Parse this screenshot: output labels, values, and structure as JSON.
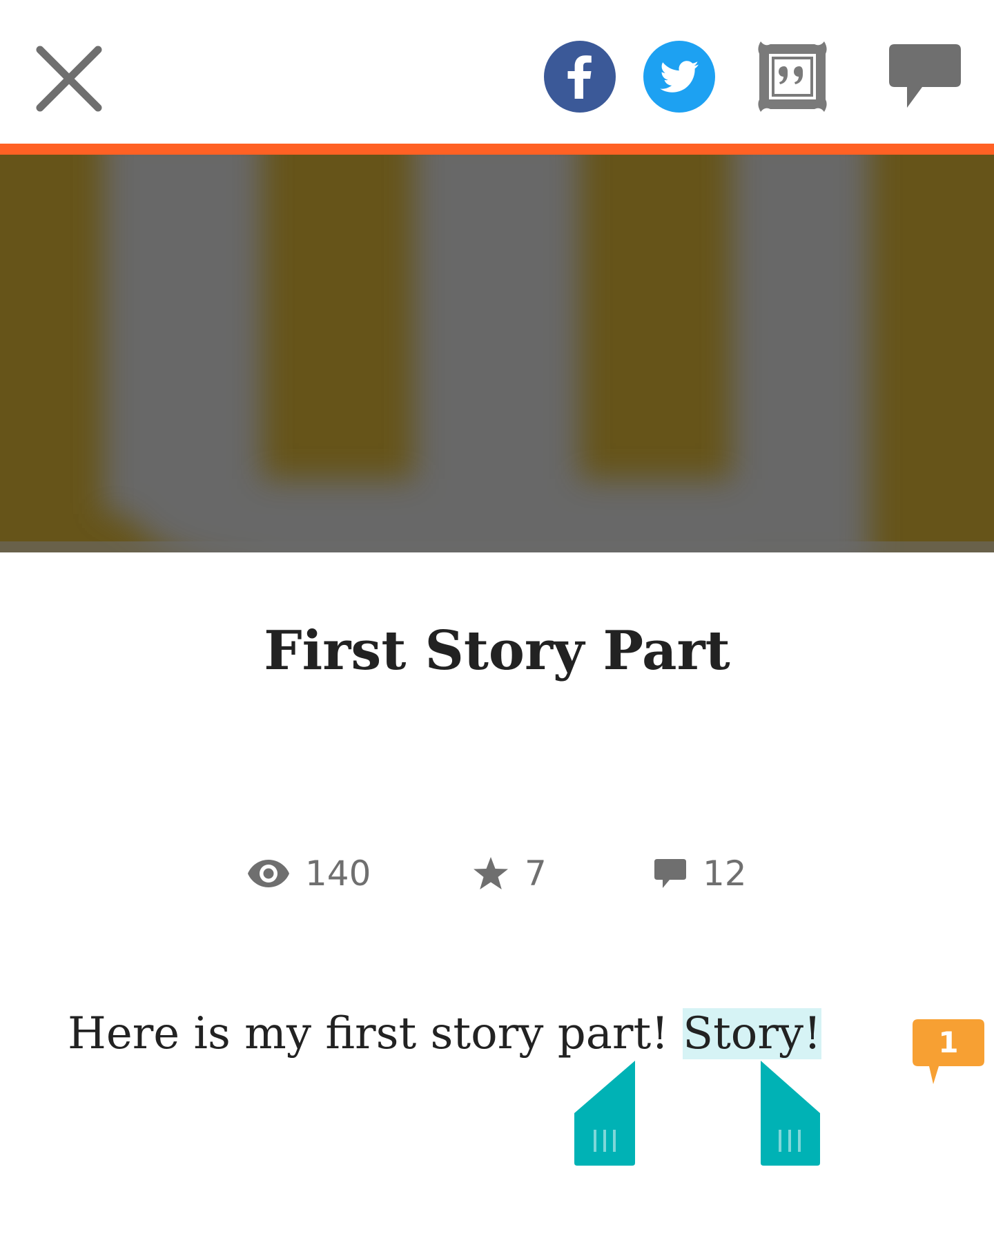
{
  "toolbar": {
    "close_icon": "close-icon",
    "share_facebook_icon": "facebook-icon",
    "share_twitter_icon": "twitter-icon",
    "quote_icon": "quote-frame-icon",
    "comments_icon": "comment-bubble-icon",
    "facebook_color": "#3b5998",
    "twitter_color": "#1da1f2",
    "icon_gray": "#6f6f6f"
  },
  "progress": {
    "fraction": 1.0,
    "color": "#ff6124"
  },
  "story": {
    "title": "First Story Part",
    "stats": {
      "reads": "140",
      "votes": "7",
      "comments": "12"
    },
    "paragraph": {
      "text_before": "Here is my first story part! ",
      "selected_text": "Story!",
      "inline_comment_count": "1",
      "inline_comment_color": "#f7a033",
      "selection_color": "#d6f3f5",
      "handle_color": "#00b2b5"
    }
  }
}
